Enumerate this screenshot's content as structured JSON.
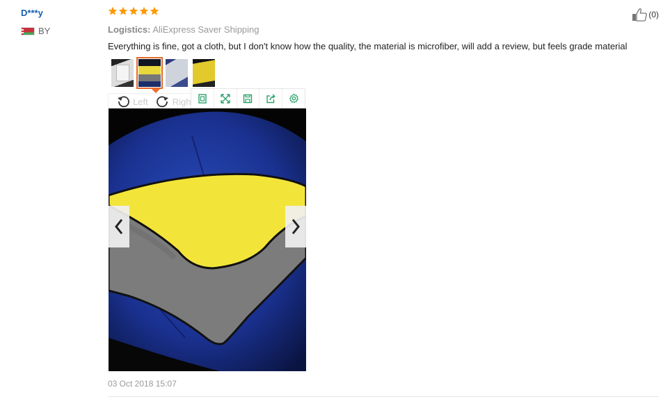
{
  "review": {
    "user": "D***y",
    "country": "BY",
    "rating": 5,
    "logistics_label": "Logistics:",
    "logistics_value": "AliExpress Saver Shipping",
    "text": "Everything is fine, got a cloth, but I don't know how the quality, the material is microfiber, will add a review, but feels grade material",
    "helpful_count": "(0)",
    "date": "03 Oct 2018 15:07"
  },
  "viewer": {
    "rotate_left": "Left",
    "rotate_right": "Right",
    "selected_thumbnail": 2,
    "tools": [
      "fit-icon",
      "fullscreen-icon",
      "save-icon",
      "share-icon",
      "settings-icon"
    ]
  },
  "colors": {
    "star": "#f90",
    "accent": "#e26b2e",
    "tool": "#2aa36b",
    "link": "#1a60b0"
  }
}
